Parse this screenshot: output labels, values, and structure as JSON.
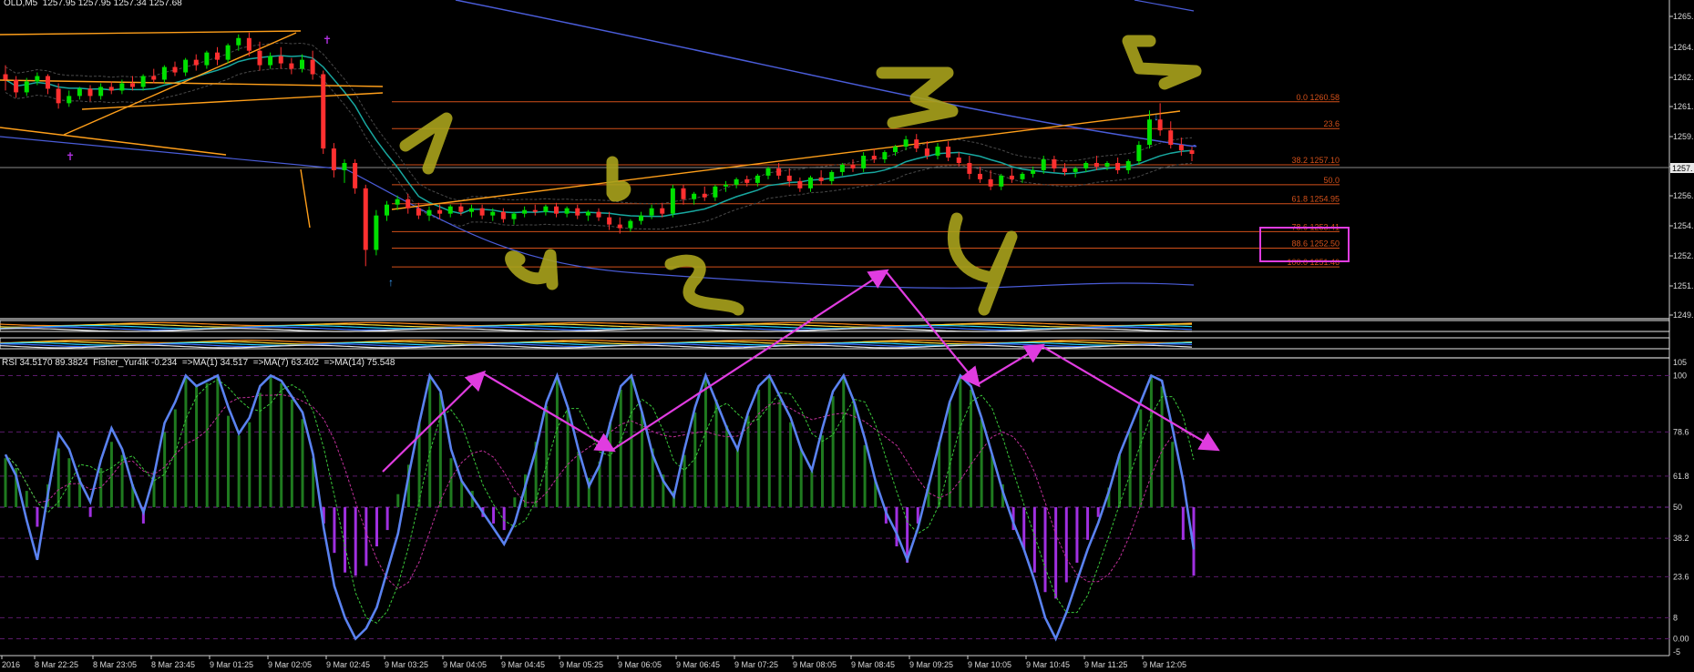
{
  "title": "OLD,M5  1257.95 1257.95 1257.34 1257.68",
  "rsi_legend": "RSI 34.5170 89.3824  Fisher_Yur4ik -0.234  =>MA(1) 34.517  =>MA(7) 63.402  =>MA(14) 75.548",
  "colors": {
    "background": "#000000",
    "bull": "#00e000",
    "bear": "#ff3030",
    "fib": "#d2501a",
    "trendline": "#ff9f1a",
    "blue_ma": "#4a5cd8",
    "cyan_ma": "#18a8a0",
    "rsi_line": "#5a82f0",
    "hist_pos": "#1f7a1f",
    "hist_neg": "#a030e0",
    "annotation_magenta": "#e03ce0",
    "handwriting": "#a8a21c",
    "text": "#d8d8d8"
  },
  "chart_data": [
    {
      "type": "candlestick",
      "price_ticks": [
        "1265.",
        "1264.",
        "1262.",
        "1261.",
        "1259.",
        "1257.",
        "1256.",
        "1254.",
        "1252.",
        "1251.",
        "1249."
      ],
      "current_price": "1257.",
      "fib_levels": [
        {
          "value": 1260.58,
          "label": "0.0 1260.58"
        },
        {
          "value": 1259.1,
          "label": "23.6"
        },
        {
          "value": 1257.1,
          "label": "38.2 1257.10"
        },
        {
          "value": 1256.0,
          "label": "50.0"
        },
        {
          "value": 1254.95,
          "label": "61.8 1254.95"
        },
        {
          "value": 1253.41,
          "label": "78.6 1253.41"
        },
        {
          "value": 1252.5,
          "label": "88.6 1252.50"
        },
        {
          "value": 1251.46,
          "label": "100.0 1251.46"
        }
      ],
      "highlighted_labels": [
        "78.6 1253.41",
        "88.6 1252.50"
      ],
      "candles": [
        {
          "o": 1262.1,
          "h": 1262.6,
          "c": 1261.8,
          "l": 1261.2
        },
        {
          "o": 1261.8,
          "h": 1262.0,
          "c": 1261.1,
          "l": 1260.8
        },
        {
          "o": 1261.1,
          "h": 1261.9,
          "c": 1261.7,
          "l": 1260.9
        },
        {
          "o": 1261.7,
          "h": 1262.2,
          "c": 1262.0,
          "l": 1261.5
        },
        {
          "o": 1262.0,
          "h": 1262.1,
          "c": 1261.3,
          "l": 1261.0
        },
        {
          "o": 1261.3,
          "h": 1261.6,
          "c": 1260.5,
          "l": 1260.2
        },
        {
          "o": 1260.5,
          "h": 1261.2,
          "c": 1260.9,
          "l": 1260.3
        },
        {
          "o": 1260.9,
          "h": 1261.4,
          "c": 1261.3,
          "l": 1260.7
        },
        {
          "o": 1261.3,
          "h": 1261.5,
          "c": 1260.9,
          "l": 1260.6
        },
        {
          "o": 1260.9,
          "h": 1261.6,
          "c": 1261.4,
          "l": 1260.7
        },
        {
          "o": 1261.4,
          "h": 1261.7,
          "c": 1261.2,
          "l": 1261.0
        },
        {
          "o": 1261.2,
          "h": 1261.8,
          "c": 1261.6,
          "l": 1261.0
        },
        {
          "o": 1261.6,
          "h": 1262.0,
          "c": 1261.4,
          "l": 1261.2
        },
        {
          "o": 1261.4,
          "h": 1262.1,
          "c": 1262.0,
          "l": 1261.2
        },
        {
          "o": 1262.0,
          "h": 1262.4,
          "c": 1261.8,
          "l": 1261.6
        },
        {
          "o": 1261.8,
          "h": 1262.6,
          "c": 1262.5,
          "l": 1261.6
        },
        {
          "o": 1262.5,
          "h": 1262.8,
          "c": 1262.2,
          "l": 1262.0
        },
        {
          "o": 1262.2,
          "h": 1263.0,
          "c": 1262.9,
          "l": 1262.0
        },
        {
          "o": 1262.9,
          "h": 1263.2,
          "c": 1262.6,
          "l": 1262.3
        },
        {
          "o": 1262.6,
          "h": 1263.4,
          "c": 1263.3,
          "l": 1262.4
        },
        {
          "o": 1263.3,
          "h": 1263.6,
          "c": 1262.9,
          "l": 1262.6
        },
        {
          "o": 1262.9,
          "h": 1263.8,
          "c": 1263.7,
          "l": 1262.7
        },
        {
          "o": 1263.7,
          "h": 1264.3,
          "c": 1264.1,
          "l": 1263.4
        },
        {
          "o": 1264.1,
          "h": 1264.4,
          "c": 1263.4,
          "l": 1263.1
        },
        {
          "o": 1263.4,
          "h": 1263.9,
          "c": 1262.6,
          "l": 1262.3
        },
        {
          "o": 1262.6,
          "h": 1263.3,
          "c": 1263.1,
          "l": 1262.4
        },
        {
          "o": 1263.1,
          "h": 1263.6,
          "c": 1262.7,
          "l": 1262.4
        },
        {
          "o": 1262.7,
          "h": 1263.0,
          "c": 1262.4,
          "l": 1262.1
        },
        {
          "o": 1262.4,
          "h": 1263.2,
          "c": 1262.9,
          "l": 1262.2
        },
        {
          "o": 1262.9,
          "h": 1263.4,
          "c": 1262.1,
          "l": 1261.8
        },
        {
          "o": 1262.1,
          "h": 1262.3,
          "c": 1258.0,
          "l": 1257.7
        },
        {
          "o": 1258.0,
          "h": 1258.3,
          "c": 1256.8,
          "l": 1256.4
        },
        {
          "o": 1256.8,
          "h": 1257.4,
          "c": 1257.2,
          "l": 1256.1
        },
        {
          "o": 1257.2,
          "h": 1257.4,
          "c": 1255.8,
          "l": 1255.5
        },
        {
          "o": 1255.8,
          "h": 1256.0,
          "c": 1252.4,
          "l": 1251.5
        },
        {
          "o": 1252.4,
          "h": 1254.6,
          "c": 1254.3,
          "l": 1252.1
        },
        {
          "o": 1254.3,
          "h": 1255.1,
          "c": 1254.9,
          "l": 1254.0
        },
        {
          "o": 1254.9,
          "h": 1255.4,
          "c": 1255.2,
          "l": 1254.6
        },
        {
          "o": 1255.2,
          "h": 1255.5,
          "c": 1254.7,
          "l": 1254.4
        },
        {
          "o": 1254.7,
          "h": 1255.0,
          "c": 1254.3,
          "l": 1254.1
        },
        {
          "o": 1254.3,
          "h": 1254.8,
          "c": 1254.6,
          "l": 1254.0
        },
        {
          "o": 1254.6,
          "h": 1254.9,
          "c": 1254.4,
          "l": 1254.1
        },
        {
          "o": 1254.4,
          "h": 1254.9,
          "c": 1254.8,
          "l": 1254.2
        },
        {
          "o": 1254.8,
          "h": 1255.0,
          "c": 1254.5,
          "l": 1254.3
        },
        {
          "o": 1254.5,
          "h": 1254.9,
          "c": 1254.7,
          "l": 1254.2
        },
        {
          "o": 1254.7,
          "h": 1254.9,
          "c": 1254.3,
          "l": 1254.1
        },
        {
          "o": 1254.3,
          "h": 1254.7,
          "c": 1254.5,
          "l": 1254.0
        },
        {
          "o": 1254.5,
          "h": 1254.7,
          "c": 1254.1,
          "l": 1253.9
        },
        {
          "o": 1254.1,
          "h": 1254.5,
          "c": 1254.4,
          "l": 1253.8
        },
        {
          "o": 1254.4,
          "h": 1254.8,
          "c": 1254.6,
          "l": 1254.2
        },
        {
          "o": 1254.6,
          "h": 1254.9,
          "c": 1254.5,
          "l": 1254.3
        },
        {
          "o": 1254.5,
          "h": 1254.9,
          "c": 1254.8,
          "l": 1254.3
        },
        {
          "o": 1254.8,
          "h": 1255.0,
          "c": 1254.4,
          "l": 1254.2
        },
        {
          "o": 1254.4,
          "h": 1254.8,
          "c": 1254.7,
          "l": 1254.2
        },
        {
          "o": 1254.7,
          "h": 1254.9,
          "c": 1254.3,
          "l": 1254.1
        },
        {
          "o": 1254.3,
          "h": 1254.6,
          "c": 1254.5,
          "l": 1254.0
        },
        {
          "o": 1254.5,
          "h": 1254.7,
          "c": 1254.2,
          "l": 1254.0
        },
        {
          "o": 1254.2,
          "h": 1254.5,
          "c": 1253.8,
          "l": 1253.5
        },
        {
          "o": 1253.8,
          "h": 1254.2,
          "c": 1253.6,
          "l": 1253.3
        },
        {
          "o": 1253.6,
          "h": 1254.1,
          "c": 1254.0,
          "l": 1253.4
        },
        {
          "o": 1254.0,
          "h": 1254.5,
          "c": 1254.3,
          "l": 1253.8
        },
        {
          "o": 1254.3,
          "h": 1254.9,
          "c": 1254.7,
          "l": 1254.1
        },
        {
          "o": 1254.7,
          "h": 1255.0,
          "c": 1254.4,
          "l": 1254.2
        },
        {
          "o": 1254.4,
          "h": 1256.0,
          "c": 1255.8,
          "l": 1254.2
        },
        {
          "o": 1255.8,
          "h": 1256.0,
          "c": 1255.2,
          "l": 1254.9
        },
        {
          "o": 1255.2,
          "h": 1255.6,
          "c": 1255.5,
          "l": 1254.9
        },
        {
          "o": 1255.5,
          "h": 1255.9,
          "c": 1255.3,
          "l": 1255.1
        },
        {
          "o": 1255.3,
          "h": 1256.0,
          "c": 1255.9,
          "l": 1255.1
        },
        {
          "o": 1255.9,
          "h": 1256.2,
          "c": 1256.0,
          "l": 1255.6
        },
        {
          "o": 1256.0,
          "h": 1256.4,
          "c": 1256.3,
          "l": 1255.8
        },
        {
          "o": 1256.3,
          "h": 1256.5,
          "c": 1256.1,
          "l": 1255.9
        },
        {
          "o": 1256.1,
          "h": 1256.6,
          "c": 1256.5,
          "l": 1255.9
        },
        {
          "o": 1256.5,
          "h": 1257.0,
          "c": 1256.9,
          "l": 1256.3
        },
        {
          "o": 1256.9,
          "h": 1257.2,
          "c": 1256.5,
          "l": 1256.3
        },
        {
          "o": 1256.5,
          "h": 1256.9,
          "c": 1256.2,
          "l": 1255.9
        },
        {
          "o": 1256.2,
          "h": 1256.4,
          "c": 1255.8,
          "l": 1255.6
        },
        {
          "o": 1255.8,
          "h": 1256.5,
          "c": 1256.4,
          "l": 1255.6
        },
        {
          "o": 1256.4,
          "h": 1256.8,
          "c": 1256.2,
          "l": 1256.0
        },
        {
          "o": 1256.2,
          "h": 1256.8,
          "c": 1256.7,
          "l": 1256.0
        },
        {
          "o": 1256.7,
          "h": 1257.2,
          "c": 1257.1,
          "l": 1256.5
        },
        {
          "o": 1257.1,
          "h": 1257.4,
          "c": 1256.9,
          "l": 1256.7
        },
        {
          "o": 1256.9,
          "h": 1257.8,
          "c": 1257.6,
          "l": 1256.7
        },
        {
          "o": 1257.6,
          "h": 1258.0,
          "c": 1257.4,
          "l": 1257.2
        },
        {
          "o": 1257.4,
          "h": 1257.9,
          "c": 1257.8,
          "l": 1257.2
        },
        {
          "o": 1257.8,
          "h": 1258.2,
          "c": 1258.1,
          "l": 1257.6
        },
        {
          "o": 1258.1,
          "h": 1258.7,
          "c": 1258.5,
          "l": 1257.9
        },
        {
          "o": 1258.5,
          "h": 1258.8,
          "c": 1258.0,
          "l": 1257.8
        },
        {
          "o": 1258.0,
          "h": 1258.4,
          "c": 1257.6,
          "l": 1257.4
        },
        {
          "o": 1257.6,
          "h": 1258.3,
          "c": 1258.1,
          "l": 1257.4
        },
        {
          "o": 1258.1,
          "h": 1258.4,
          "c": 1257.5,
          "l": 1257.3
        },
        {
          "o": 1257.5,
          "h": 1257.8,
          "c": 1257.2,
          "l": 1257.0
        },
        {
          "o": 1257.2,
          "h": 1257.6,
          "c": 1256.6,
          "l": 1256.3
        },
        {
          "o": 1256.6,
          "h": 1257.0,
          "c": 1256.3,
          "l": 1256.1
        },
        {
          "o": 1256.3,
          "h": 1256.8,
          "c": 1255.9,
          "l": 1255.7
        },
        {
          "o": 1255.9,
          "h": 1256.6,
          "c": 1256.5,
          "l": 1255.7
        },
        {
          "o": 1256.5,
          "h": 1256.9,
          "c": 1256.3,
          "l": 1256.1
        },
        {
          "o": 1256.3,
          "h": 1256.7,
          "c": 1256.6,
          "l": 1256.1
        },
        {
          "o": 1256.6,
          "h": 1257.0,
          "c": 1256.8,
          "l": 1256.4
        },
        {
          "o": 1256.8,
          "h": 1257.6,
          "c": 1257.4,
          "l": 1256.6
        },
        {
          "o": 1257.4,
          "h": 1257.6,
          "c": 1256.9,
          "l": 1256.7
        },
        {
          "o": 1256.9,
          "h": 1257.2,
          "c": 1256.7,
          "l": 1256.5
        },
        {
          "o": 1256.7,
          "h": 1257.0,
          "c": 1256.9,
          "l": 1256.4
        },
        {
          "o": 1256.9,
          "h": 1257.3,
          "c": 1257.2,
          "l": 1256.7
        },
        {
          "o": 1257.2,
          "h": 1257.6,
          "c": 1257.0,
          "l": 1256.8
        },
        {
          "o": 1257.0,
          "h": 1257.3,
          "c": 1257.2,
          "l": 1256.8
        },
        {
          "o": 1257.2,
          "h": 1257.5,
          "c": 1256.8,
          "l": 1256.6
        },
        {
          "o": 1256.8,
          "h": 1257.4,
          "c": 1257.3,
          "l": 1256.6
        },
        {
          "o": 1257.3,
          "h": 1258.4,
          "c": 1258.2,
          "l": 1257.1
        },
        {
          "o": 1258.2,
          "h": 1260.1,
          "c": 1259.6,
          "l": 1258.0
        },
        {
          "o": 1259.6,
          "h": 1260.5,
          "c": 1259.0,
          "l": 1258.7
        },
        {
          "o": 1259.0,
          "h": 1259.5,
          "c": 1258.2,
          "l": 1258.0
        },
        {
          "o": 1258.2,
          "h": 1258.6,
          "c": 1257.9,
          "l": 1257.6
        },
        {
          "o": 1257.9,
          "h": 1258.1,
          "c": 1257.7,
          "l": 1257.3
        }
      ]
    },
    {
      "type": "line",
      "title": "RSI",
      "y_ticks": [
        "105",
        "100",
        "78.6",
        "61.8",
        "50",
        "38.2",
        "23.6",
        "8",
        "0.00",
        "-5"
      ],
      "x_labels": [
        "2016",
        "8 Mar 22:25",
        "8 Mar 23:05",
        "8 Mar 23:45",
        "9 Mar 01:25",
        "9 Mar 02:05",
        "9 Mar 02:45",
        "9 Mar 03:25",
        "9 Mar 04:05",
        "9 Mar 04:45",
        "9 Mar 05:25",
        "9 Mar 06:05",
        "9 Mar 06:45",
        "9 Mar 07:25",
        "9 Mar 08:05",
        "9 Mar 08:45",
        "9 Mar 09:25",
        "9 Mar 10:05",
        "9 Mar 10:45",
        "9 Mar 11:25",
        "9 Mar 12:05"
      ],
      "rsi": [
        70,
        62,
        45,
        30,
        55,
        78,
        72,
        60,
        52,
        68,
        80,
        72,
        58,
        48,
        62,
        82,
        90,
        100,
        96,
        98,
        100,
        88,
        78,
        84,
        96,
        100,
        98,
        92,
        86,
        70,
        42,
        20,
        8,
        0,
        4,
        12,
        26,
        40,
        62,
        82,
        100,
        94,
        72,
        60,
        54,
        48,
        42,
        36,
        44,
        58,
        72,
        90,
        100,
        88,
        72,
        58,
        66,
        82,
        96,
        100,
        86,
        70,
        60,
        54,
        72,
        88,
        100,
        90,
        80,
        72,
        86,
        96,
        100,
        92,
        84,
        72,
        64,
        80,
        94,
        100,
        90,
        76,
        60,
        48,
        40,
        30,
        42,
        58,
        74,
        90,
        100,
        96,
        84,
        70,
        56,
        44,
        34,
        22,
        8,
        0,
        10,
        22,
        34,
        44,
        56,
        70,
        80,
        90,
        100,
        98,
        80,
        60,
        34
      ],
      "hist": [
        30,
        24,
        10,
        -12,
        14,
        36,
        30,
        18,
        -6,
        24,
        40,
        32,
        14,
        -10,
        22,
        46,
        60,
        80,
        74,
        76,
        80,
        56,
        44,
        52,
        70,
        80,
        76,
        66,
        54,
        30,
        -10,
        -28,
        -40,
        -42,
        -36,
        -24,
        -14,
        8,
        26,
        52,
        80,
        70,
        30,
        16,
        10,
        -6,
        -10,
        -14,
        6,
        20,
        40,
        62,
        80,
        60,
        34,
        18,
        28,
        52,
        72,
        80,
        58,
        36,
        20,
        10,
        32,
        58,
        80,
        66,
        50,
        36,
        56,
        72,
        80,
        66,
        52,
        36,
        22,
        44,
        68,
        80,
        64,
        38,
        16,
        -10,
        -24,
        -34,
        -10,
        14,
        40,
        64,
        80,
        72,
        54,
        32,
        14,
        -14,
        -26,
        -40,
        -52,
        -56,
        -46,
        -34,
        -20,
        -6,
        12,
        32,
        46,
        60,
        80,
        74,
        40,
        -20,
        -42
      ],
      "magenta_arrows": [
        {
          "from": [
            346,
            35
          ],
          "to": [
            447,
            96
          ]
        },
        {
          "from": [
            447,
            96
          ],
          "to": [
            561,
            36
          ]
        },
        {
          "from": [
            561,
            36
          ],
          "to": [
            815,
            95
          ]
        },
        {
          "from": [
            815,
            95
          ],
          "to": [
            896,
            31
          ]
        },
        {
          "from": [
            896,
            31
          ],
          "to": [
            959,
            96
          ]
        },
        {
          "from": [
            959,
            96
          ],
          "to": [
            1124,
            24
          ]
        }
      ]
    }
  ],
  "handwriting_labels": [
    "1",
    "a",
    "b",
    "2",
    "3",
    "4",
    "5"
  ]
}
